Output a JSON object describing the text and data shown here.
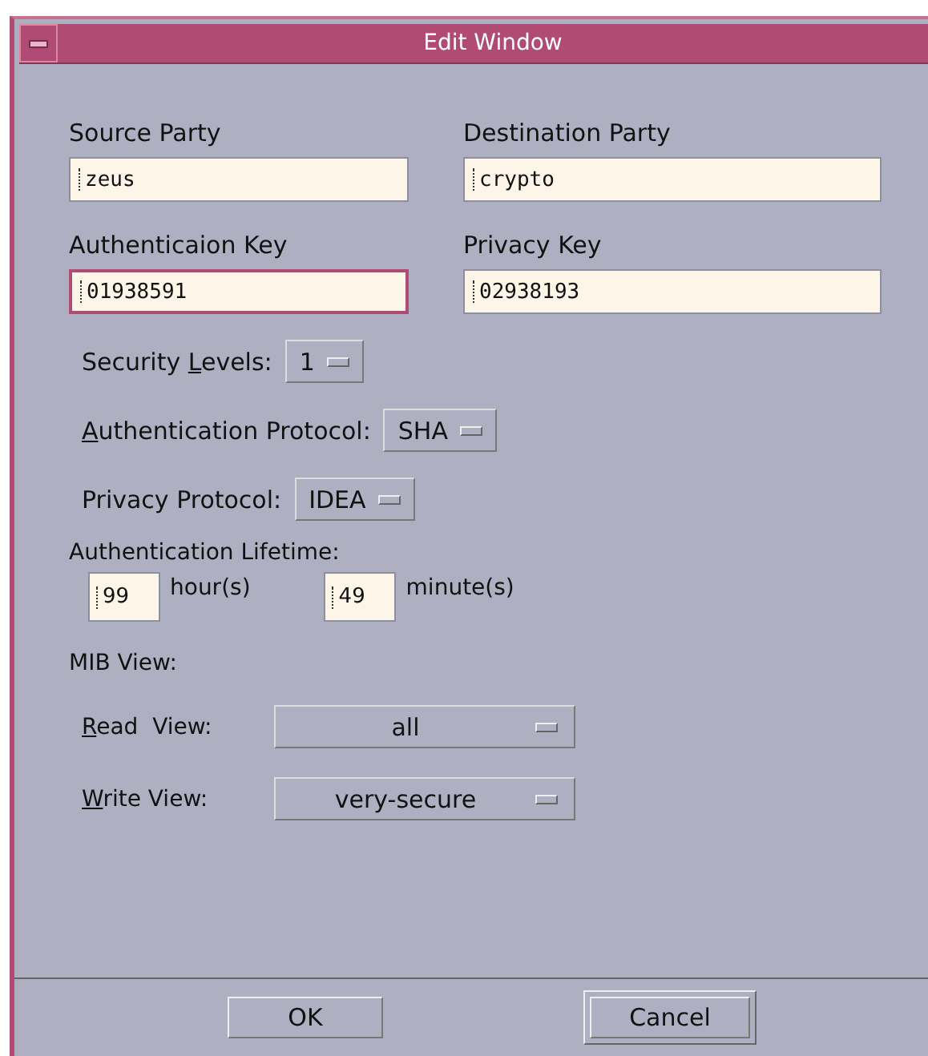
{
  "window": {
    "title": "Edit Window"
  },
  "fields": [
    {
      "label": "Source Party",
      "value": "zeus",
      "focused": false
    },
    {
      "label": "Destination Party",
      "value": "crypto",
      "focused": false
    },
    {
      "label": "Authenticaion Key",
      "value": "01938591",
      "focused": true
    },
    {
      "label": "Privacy Key",
      "value": "02938193",
      "focused": false
    }
  ],
  "options": [
    {
      "label_parts": {
        "before": "Security ",
        "key": "L",
        "after": "evels:"
      },
      "value": "1"
    },
    {
      "label_parts": {
        "key": "A",
        "after": "uthentication Protocol:"
      },
      "value": "SHA"
    },
    {
      "label_parts": {
        "before": "Privacy Protocol:"
      },
      "value": "IDEA"
    }
  ],
  "lifetime": {
    "label": "Authentication Lifetime:",
    "hours": {
      "value": "99",
      "unit": "hour(s)"
    },
    "minutes": {
      "value": "49",
      "unit": "minute(s)"
    }
  },
  "mib_view": {
    "label": "MIB View:",
    "views": [
      {
        "label_parts": {
          "key": "R",
          "after": "ead  View:"
        },
        "value": "all"
      },
      {
        "label_parts": {
          "key": "W",
          "after": "rite View:"
        },
        "value": "very-secure"
      }
    ]
  },
  "buttons": [
    {
      "label": "OK",
      "default": false
    },
    {
      "label": "Cancel",
      "default": true
    }
  ]
}
